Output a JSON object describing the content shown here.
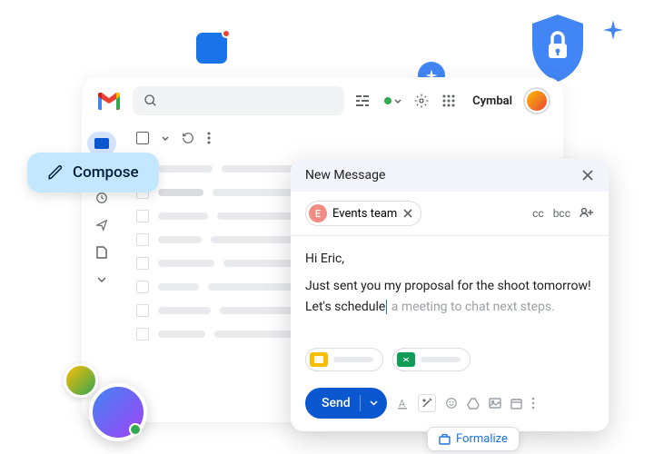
{
  "header": {
    "brand": "Cymbal"
  },
  "compose_chip": {
    "label": "Compose"
  },
  "compose_window": {
    "title": "New Message",
    "recipient": {
      "initial": "E",
      "name": "Events team"
    },
    "cc_label": "cc",
    "bcc_label": "bcc",
    "body": {
      "greeting": "Hi Eric,",
      "line1": "Just sent you my proposal for the shoot tomorrow!",
      "line2_typed": "Let's schedule",
      "line2_ghost": " a meeting to chat next steps."
    },
    "send_label": "Send"
  },
  "formalize": {
    "label": "Formalize"
  },
  "colors": {
    "primary": "#0b57d0",
    "blue": "#4285f4",
    "red": "#ea4335",
    "yellow": "#fbbc04",
    "green": "#34a853"
  }
}
